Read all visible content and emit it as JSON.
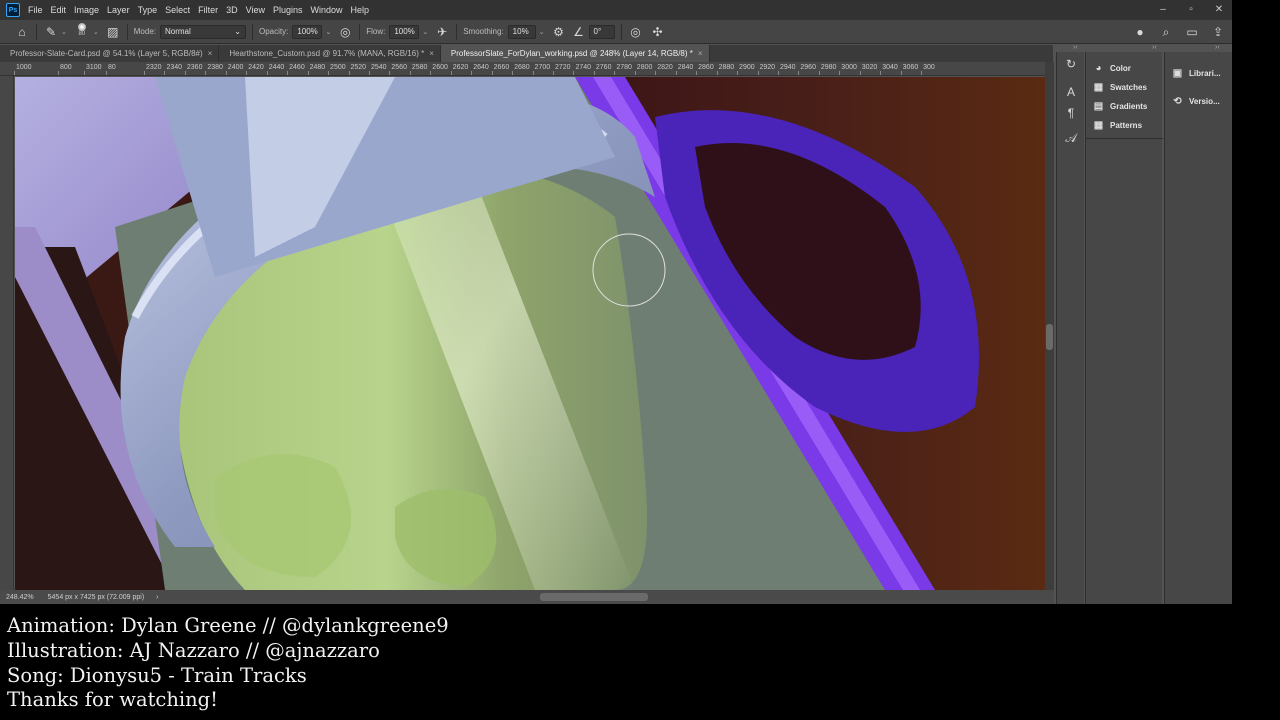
{
  "menu": [
    "File",
    "Edit",
    "Image",
    "Layer",
    "Type",
    "Select",
    "Filter",
    "3D",
    "View",
    "Plugins",
    "Window",
    "Help"
  ],
  "options": {
    "brush_size": "80",
    "mode_label": "Mode:",
    "mode_value": "Normal",
    "opacity_label": "Opacity:",
    "opacity_value": "100%",
    "flow_label": "Flow:",
    "flow_value": "100%",
    "smoothing_label": "Smoothing:",
    "smoothing_value": "10%",
    "angle_value": "0°"
  },
  "tabs": [
    {
      "label": "Professor-Slate-Card.psd @ 54.1% (Layer 5, RGB/8#)",
      "close": "×"
    },
    {
      "label": "Hearthstone_Custom.psd @ 91.7% (MANA, RGB/16) *",
      "close": "×"
    },
    {
      "label": "ProfessorSlate_ForDylan_working.psd @ 248% (Layer 14, RGB/8) *",
      "close": "×"
    }
  ],
  "ruler": [
    "1000",
    "800",
    "3100",
    "80",
    "2320",
    "2340",
    "2360",
    "2380",
    "2400",
    "2420",
    "2440",
    "2460",
    "2480",
    "2500",
    "2520",
    "2540",
    "2560",
    "2580",
    "2600",
    "2620",
    "2640",
    "2660",
    "2680",
    "2700",
    "2720",
    "2740",
    "2760",
    "2780",
    "2800",
    "2820",
    "2840",
    "2860",
    "2880",
    "2900",
    "2920",
    "2940",
    "2960",
    "2980",
    "3000",
    "3020",
    "3040",
    "3060",
    "300"
  ],
  "status": {
    "zoom": "248.42%",
    "doc_size": "5454 px x 7425 px (72.009 ppi)",
    "arrow": "›"
  },
  "panels": {
    "main": [
      {
        "label": "Color",
        "icon": "color-icon"
      },
      {
        "label": "Swatches",
        "icon": "swatches-icon"
      },
      {
        "label": "Gradients",
        "icon": "gradients-icon"
      },
      {
        "label": "Patterns",
        "icon": "patterns-icon"
      }
    ],
    "secondary": [
      {
        "label": "Librari...",
        "icon": "libraries-icon"
      },
      {
        "label": "Versio...",
        "icon": "versions-icon"
      }
    ]
  },
  "caption": [
    "Animation: Dylan Greene // @dylankgreene9",
    "Illustration: AJ Nazzaro // @ajnazzaro",
    "Song: Dionysu5 - Train Tracks",
    "Thanks for watching!"
  ],
  "colors": {
    "accent": "#31a8ff",
    "canvas_green": "#9db86a",
    "canvas_purple": "#6a2fd6",
    "canvas_maroon": "#4a1a1c"
  }
}
